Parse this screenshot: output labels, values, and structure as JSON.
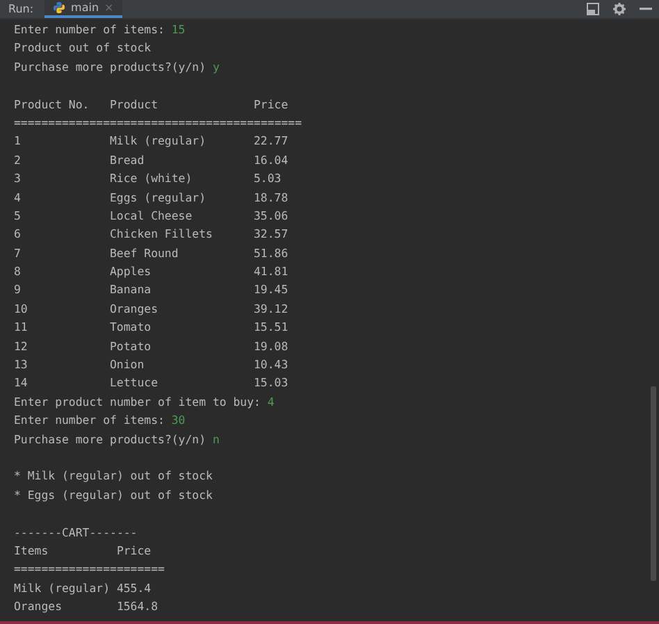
{
  "toolbar": {
    "label": "Run:",
    "tab": {
      "label": "main",
      "close": "×",
      "selected": true
    }
  },
  "console": [
    {
      "kind": "prompt",
      "text": "Enter number of items: ",
      "input": "15"
    },
    {
      "kind": "text",
      "text": "Product out of stock"
    },
    {
      "kind": "prompt",
      "text": "Purchase more products?(y/n) ",
      "input": "y"
    },
    {
      "kind": "blank"
    },
    {
      "kind": "table",
      "columns": [
        "Product No.",
        "Product",
        "Price"
      ],
      "rule": "==========================================",
      "rows": [
        [
          "1",
          "Milk (regular)",
          "22.77"
        ],
        [
          "2",
          "Bread",
          "16.04"
        ],
        [
          "3",
          "Rice (white)",
          "5.03"
        ],
        [
          "4",
          "Eggs (regular)",
          "18.78"
        ],
        [
          "5",
          "Local Cheese",
          "35.06"
        ],
        [
          "6",
          "Chicken Fillets",
          "32.57"
        ],
        [
          "7",
          "Beef Round",
          "51.86"
        ],
        [
          "8",
          "Apples",
          "41.81"
        ],
        [
          "9",
          "Banana",
          "19.45"
        ],
        [
          "10",
          "Oranges",
          "39.12"
        ],
        [
          "11",
          "Tomato",
          "15.51"
        ],
        [
          "12",
          "Potato",
          "19.08"
        ],
        [
          "13",
          "Onion",
          "10.43"
        ],
        [
          "14",
          "Lettuce",
          "15.03"
        ]
      ]
    },
    {
      "kind": "prompt",
      "text": "Enter product number of item to buy: ",
      "input": "4"
    },
    {
      "kind": "prompt",
      "text": "Enter number of items: ",
      "input": "30"
    },
    {
      "kind": "prompt",
      "text": "Purchase more products?(y/n) ",
      "input": "n"
    },
    {
      "kind": "blank"
    },
    {
      "kind": "text",
      "text": "* Milk (regular) out of stock"
    },
    {
      "kind": "text",
      "text": "* Eggs (regular) out of stock"
    },
    {
      "kind": "blank"
    },
    {
      "kind": "text",
      "text": "-------CART-------"
    },
    {
      "kind": "table",
      "columns": [
        "Items",
        "Price"
      ],
      "rule": "======================",
      "rows": [
        [
          "Milk (regular)",
          "455.4"
        ],
        [
          "Oranges",
          "1564.8"
        ]
      ]
    }
  ]
}
